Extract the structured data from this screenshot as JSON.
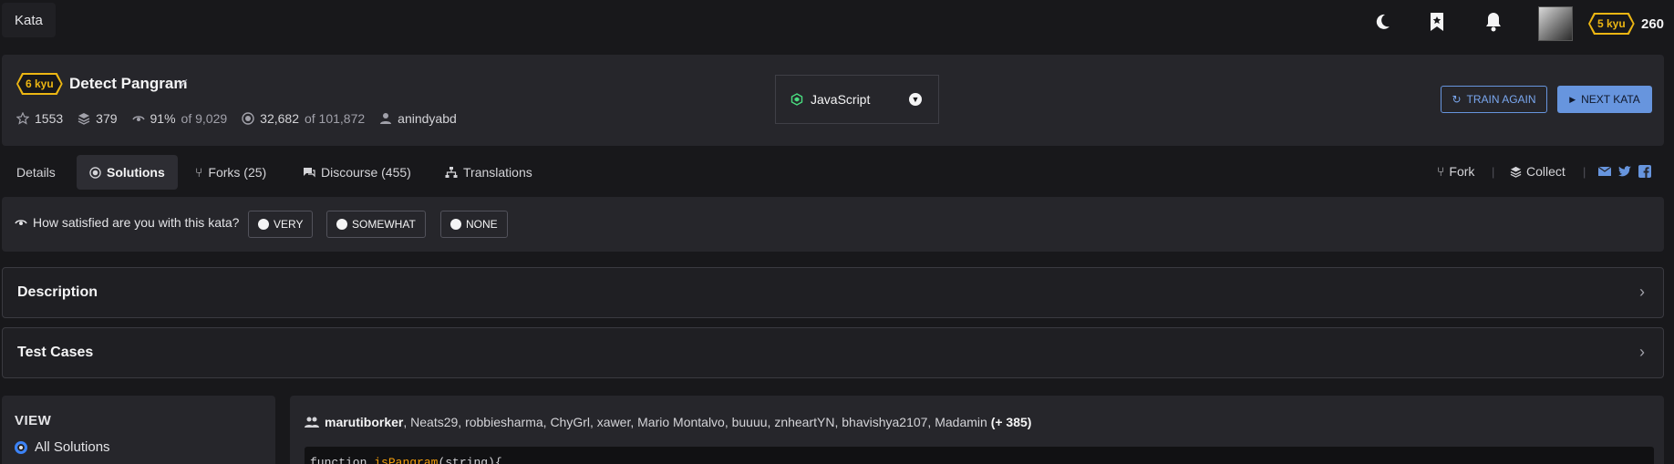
{
  "breadcrumb": {
    "label": "Kata"
  },
  "user": {
    "rank": "5 kyu",
    "honor": "260"
  },
  "kata": {
    "rank": "6 kyu",
    "title": "Detect Pangram",
    "stats": {
      "stars": "1553",
      "collections": "379",
      "satisfaction_pct": "91%",
      "satisfaction_of": "of 9,029",
      "completed": "32,682",
      "completed_of": "of 101,872",
      "author": "anindyabd"
    },
    "language": "JavaScript",
    "train_again_label": "TRAIN AGAIN",
    "next_kata_label": "NEXT KATA"
  },
  "tabs": {
    "details": "Details",
    "solutions": "Solutions",
    "forks": "Forks (25)",
    "discourse": "Discourse (455)",
    "translations": "Translations"
  },
  "actions": {
    "fork": "Fork",
    "collect": "Collect"
  },
  "survey": {
    "question": "How satisfied are you with this kata?",
    "very": "VERY",
    "somewhat": "SOMEWHAT",
    "none": "NONE"
  },
  "sections": {
    "description": "Description",
    "test_cases": "Test Cases"
  },
  "view": {
    "title": "VIEW",
    "all_solutions": "All Solutions"
  },
  "solution": {
    "lead_user": "marutiborker",
    "other_users": ", Neats29, robbiesharma, ChyGrl, xawer, Mario Montalvo, buuuu, znheartYN, bhavishya2107, Madamin",
    "more": "(+ 385)",
    "code_keyword": "function",
    "code_name": "isPangram",
    "code_rest": "(string){"
  },
  "colors": {
    "accent": "#6795de",
    "rank_yellow": "#ecb613",
    "panel": "#26262b",
    "background": "#18181b"
  }
}
